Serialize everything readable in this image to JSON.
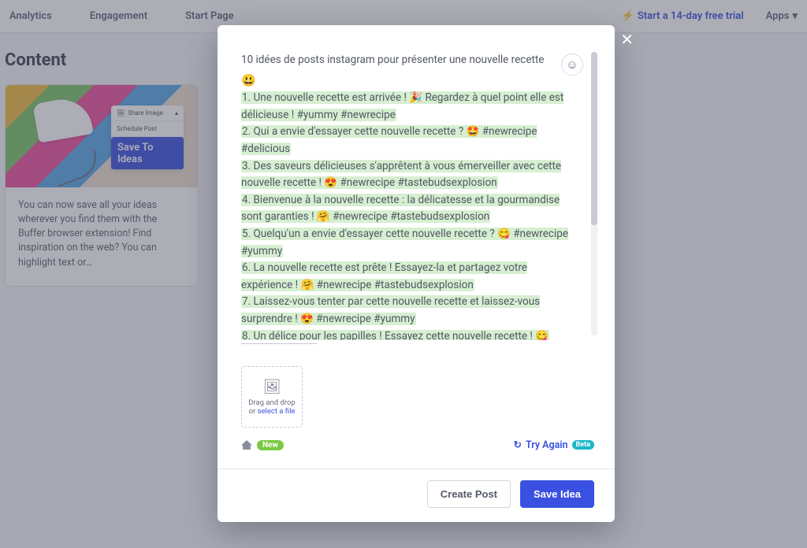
{
  "nav": {
    "analytics": "Analytics",
    "engagement": "Engagement",
    "start_page": "Start Page",
    "trial": "Start a 14-day free trial",
    "apps": "Apps"
  },
  "page": {
    "heading": "Content"
  },
  "promo": {
    "share_image": "Share Image",
    "schedule_post": "Schedule Post",
    "save_to_ideas": "Save To Ideas",
    "body": "You can now save all your ideas wherever you find them with the Buffer browser extension! Find inspiration on the web? You can highlight text or…"
  },
  "modal": {
    "intro": "10 idées de posts instagram pour présenter une nouvelle recette",
    "intro_emoji": "😃",
    "ideas": [
      "1. Une nouvelle recette est arrivée ! 🎉  Regardez à quel point elle est délicieuse ! #yummy #newrecipe",
      "2. Qui a envie d'essayer cette nouvelle recette ? 🤩 #newrecipe #delicious",
      "3. Des saveurs délicieuses s'apprêtent à vous émerveiller avec cette nouvelle recette ! 😍 #newrecipe #tastebudsexplosion",
      "4. Bienvenue à la nouvelle recette : la délicatesse et la gourmandise sont garanties ! 🤗 #newrecipe #tastebudsexplosion",
      "5. Quelqu'un a envie d'essayer cette nouvelle recette ? 😋 #newrecipe #yummy",
      "6. La nouvelle recette est prête ! Essayez-la et partagez votre expérience ! 🤗 #newrecipe #tastebudsexplosion",
      "7. Laissez-vous tenter par cette nouvelle recette et laissez-vous surprendre ! 😍 #newrecipe #yummy",
      "8. Un délice pour les papilles ! Essayez cette nouvelle recette ! 😋"
    ],
    "upload": {
      "line1": "Drag and drop",
      "line2_prefix": "or ",
      "line2_link": "select a file"
    },
    "new_badge": "New",
    "try_again": "Try Again",
    "beta": "Beta",
    "create_post": "Create Post",
    "save_idea": "Save Idea"
  }
}
